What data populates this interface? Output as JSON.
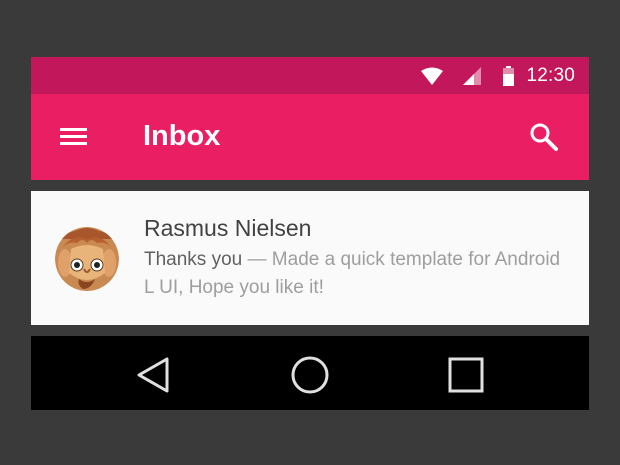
{
  "status_bar": {
    "time": "12:30",
    "icons": [
      "wifi-icon",
      "signal-icon",
      "battery-icon"
    ]
  },
  "app_bar": {
    "title": "Inbox",
    "menu_icon": "menu-icon",
    "search_icon": "search-icon"
  },
  "messages": [
    {
      "sender": "Rasmus Nielsen",
      "subject": "Thanks you",
      "separator": " — ",
      "snippet": "Made a quick template for Android L UI, Hope you like it!",
      "avatar_icon": "avatar-illustration"
    }
  ],
  "nav_bar": {
    "icons": [
      "back-icon",
      "home-icon",
      "recents-icon"
    ]
  },
  "colors": {
    "status_bar": "#c2185b",
    "app_bar": "#e91e63",
    "page_background": "#3a3a3a",
    "list_background": "#fafafa",
    "nav_bar": "#000000"
  }
}
